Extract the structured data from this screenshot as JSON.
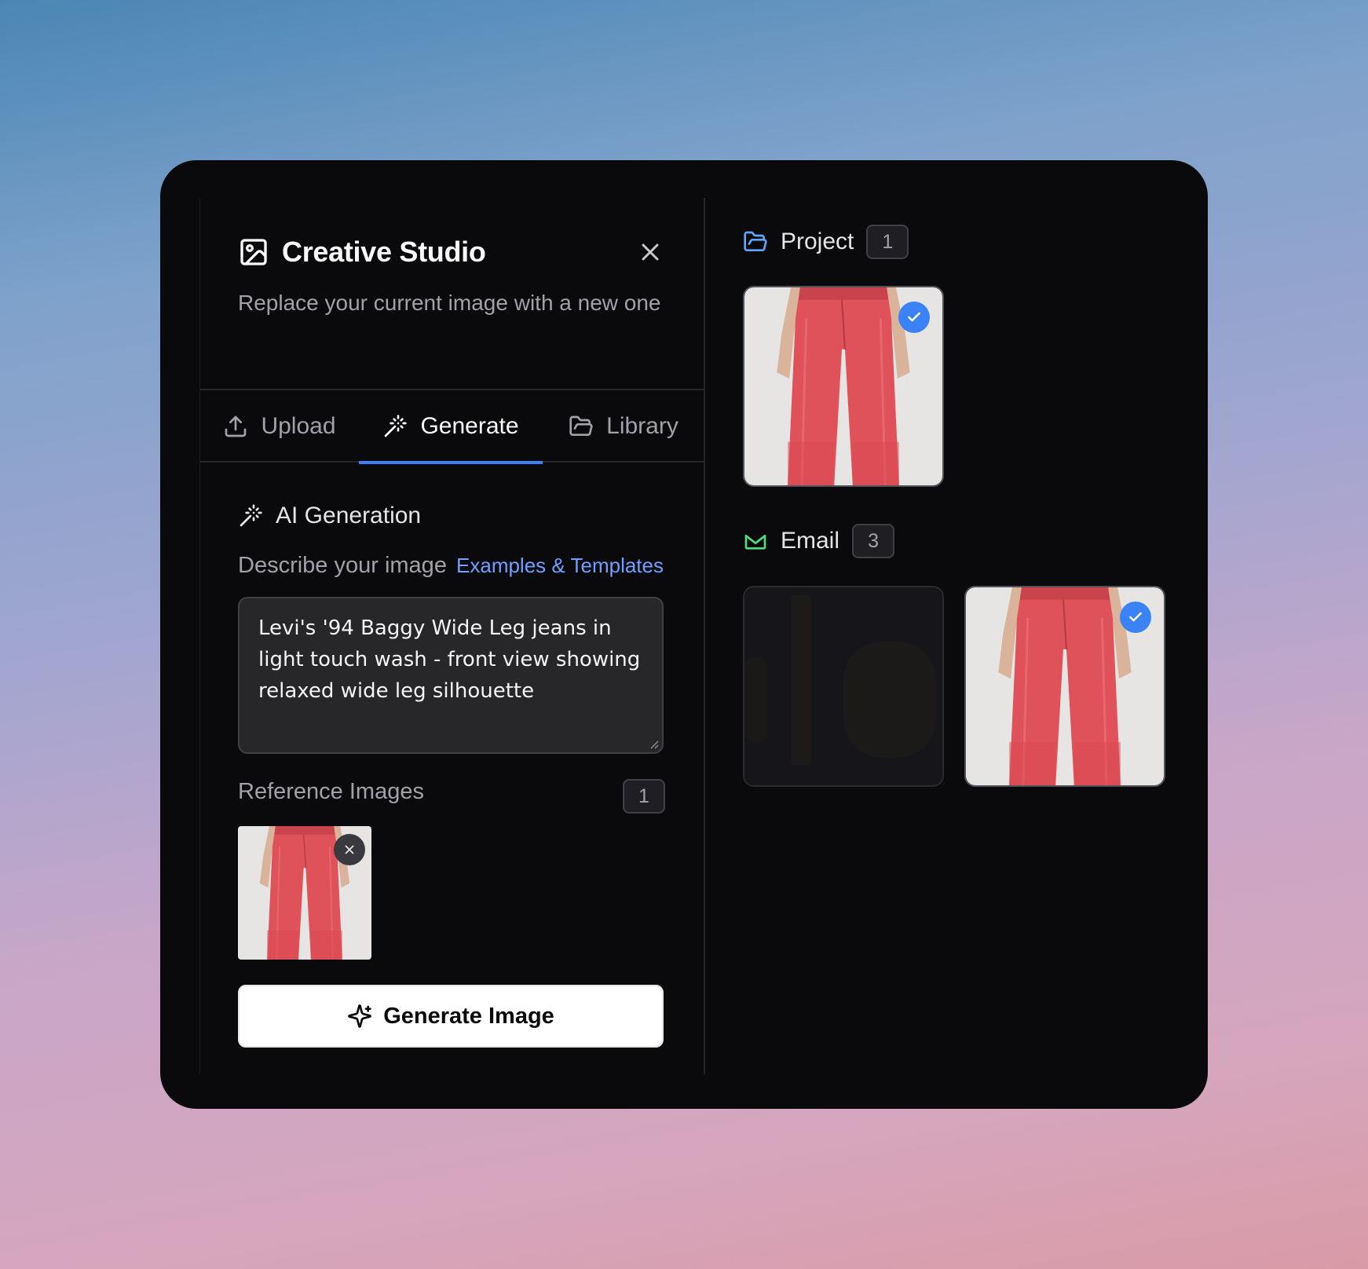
{
  "header": {
    "title": "Creative Studio",
    "subtitle": "Replace your current image with a new one"
  },
  "tabs": [
    {
      "label": "Upload",
      "icon": "upload-icon",
      "active": false
    },
    {
      "label": "Generate",
      "icon": "magic-wand-icon",
      "active": true
    },
    {
      "label": "Library",
      "icon": "folder-icon",
      "active": false
    }
  ],
  "generate": {
    "section_title": "AI Generation",
    "describe_label": "Describe your image",
    "examples_link": "Examples & Templates",
    "prompt_value": "Levi's '94 Baggy Wide Leg jeans in light touch wash - front view showing relaxed wide leg silhouette",
    "reference_label": "Reference Images",
    "reference_count": "1",
    "button_label": "Generate Image"
  },
  "library": {
    "groups": [
      {
        "name": "Project",
        "count": "1",
        "icon": "folder-icon",
        "icon_color": "#60a5fa"
      },
      {
        "name": "Email",
        "count": "3",
        "icon": "mail-icon",
        "icon_color": "#4ade80"
      }
    ]
  },
  "colors": {
    "accent": "#3b82f6",
    "link": "#6ea0ff",
    "modal_bg": "#0a0a0c",
    "jeans": "#e0525a"
  }
}
